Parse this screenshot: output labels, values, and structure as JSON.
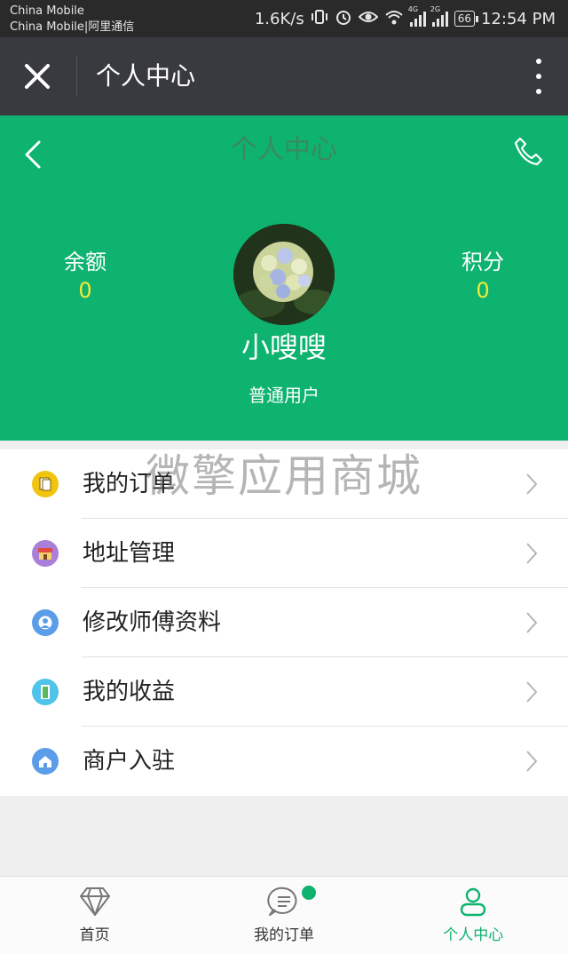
{
  "status_bar": {
    "carrier_1": "China Mobile",
    "carrier_2": "China Mobile|阿里通信",
    "speed": "1.6K/s",
    "net_4g": "4G",
    "net_2g": "2G",
    "battery": "66",
    "time": "12:54 PM"
  },
  "wx_bar": {
    "title": "个人中心"
  },
  "header": {
    "title": "个人中心",
    "balance_label": "余额",
    "balance_value": "0",
    "points_label": "积分",
    "points_value": "0",
    "username": "小嗖嗖",
    "role": "普通用户",
    "accent_color": "#0db36e",
    "value_color": "#f4e93a"
  },
  "menu": {
    "items": [
      {
        "label": "我的订单",
        "icon": "document-icon",
        "color": "#f1c40f"
      },
      {
        "label": "地址管理",
        "icon": "store-icon",
        "color": "#a97fd8"
      },
      {
        "label": "修改师傅资料",
        "icon": "user-icon",
        "color": "#5b9de8"
      },
      {
        "label": "我的收益",
        "icon": "door-icon",
        "color": "#4fc3e8"
      },
      {
        "label": "商户入驻",
        "icon": "home-icon",
        "color": "#5b9de8"
      }
    ]
  },
  "watermark": "微擎应用商城",
  "tabbar": {
    "tabs": [
      {
        "label": "首页",
        "icon": "diamond-icon"
      },
      {
        "label": "我的订单",
        "icon": "message-icon"
      },
      {
        "label": "个人中心",
        "icon": "person-icon"
      }
    ],
    "active_index": 2
  }
}
